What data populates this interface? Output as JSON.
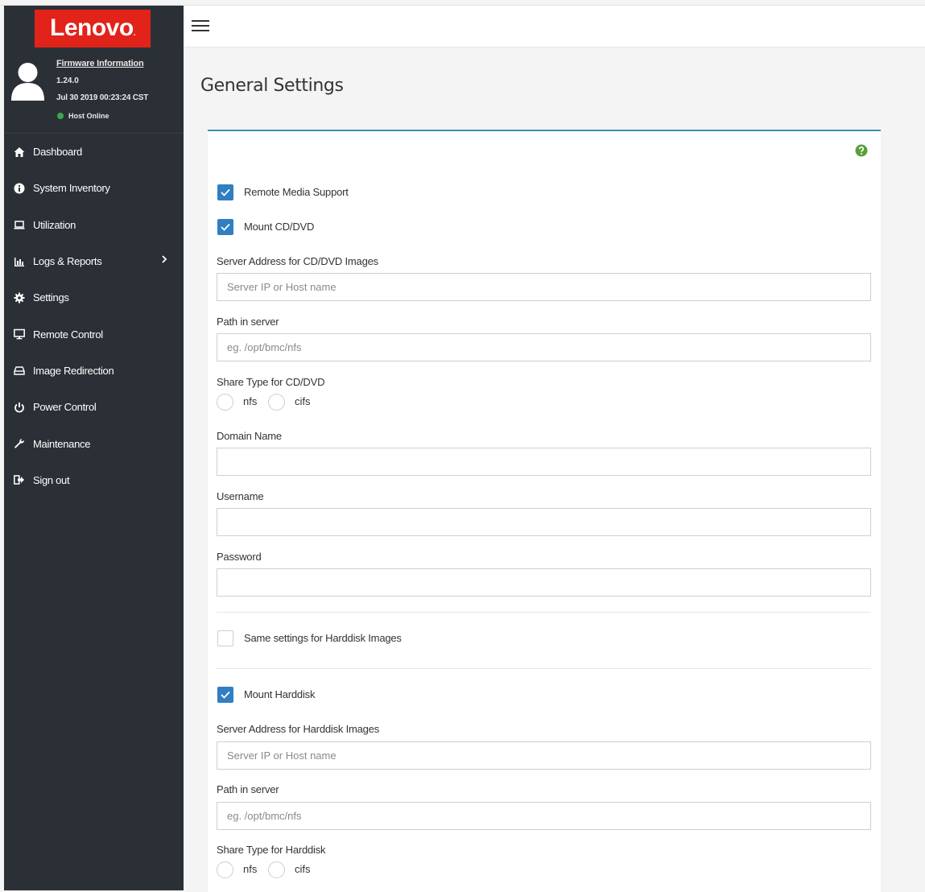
{
  "brand": {
    "logo_text": "Lenovo",
    "color": "#e2231a"
  },
  "user": {
    "firmware_link": "Firmware Information",
    "version": "1.24.0",
    "build_date": "Jul 30 2019 00:23:24 CST",
    "host_status": "Host Online",
    "host_status_color": "#3ca84b"
  },
  "sidebar": {
    "items": [
      {
        "label": "Dashboard",
        "icon": "home-icon"
      },
      {
        "label": "System Inventory",
        "icon": "info-icon"
      },
      {
        "label": "Utilization",
        "icon": "laptop-icon"
      },
      {
        "label": "Logs & Reports",
        "icon": "bar-chart-icon",
        "has_submenu": true
      },
      {
        "label": "Settings",
        "icon": "gear-icon"
      },
      {
        "label": "Remote Control",
        "icon": "monitor-icon"
      },
      {
        "label": "Image Redirection",
        "icon": "hdd-icon"
      },
      {
        "label": "Power Control",
        "icon": "power-icon"
      },
      {
        "label": "Maintenance",
        "icon": "wrench-icon"
      },
      {
        "label": "Sign out",
        "icon": "sign-out-icon"
      }
    ]
  },
  "page": {
    "title": "General Settings"
  },
  "form": {
    "remote_media_support": {
      "label": "Remote Media Support",
      "checked": true
    },
    "mount_cd": {
      "label": "Mount CD/DVD",
      "checked": true
    },
    "cd_server_address": {
      "label": "Server Address for CD/DVD Images",
      "placeholder": "Server IP or Host name",
      "value": ""
    },
    "cd_path": {
      "label": "Path in server",
      "placeholder": "eg. /opt/bmc/nfs",
      "value": ""
    },
    "cd_share_type": {
      "label": "Share Type for CD/DVD",
      "options": [
        "nfs",
        "cifs"
      ],
      "selected": null
    },
    "domain_name": {
      "label": "Domain Name",
      "value": ""
    },
    "username": {
      "label": "Username",
      "value": ""
    },
    "password": {
      "label": "Password",
      "value": ""
    },
    "same_settings_hd": {
      "label": "Same settings for Harddisk Images",
      "checked": false
    },
    "mount_hd": {
      "label": "Mount Harddisk",
      "checked": true
    },
    "hd_server_address": {
      "label": "Server Address for Harddisk Images",
      "placeholder": "Server IP or Host name",
      "value": ""
    },
    "hd_path": {
      "label": "Path in server",
      "placeholder": "eg. /opt/bmc/nfs",
      "value": ""
    },
    "hd_share_type": {
      "label": "Share Type for Harddisk",
      "options": [
        "nfs",
        "cifs"
      ],
      "selected": null
    }
  },
  "colors": {
    "sidebar_bg": "#2b3036",
    "accent": "#2f7fc1",
    "card_border": "#3c8dbc",
    "help": "#5a9e3c"
  }
}
